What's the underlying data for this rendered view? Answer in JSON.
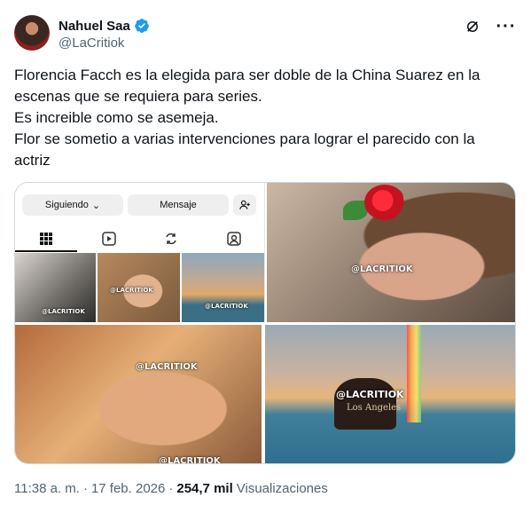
{
  "author": {
    "display_name": "Nahuel Saa",
    "handle": "@LaCritiok",
    "verified": true,
    "verified_color": "#1d9bf0"
  },
  "header_icons": [
    "grok-icon",
    "more-icon"
  ],
  "more_label": "···",
  "text_lines": [
    "Florencia Facch es la elegida para ser doble de la China Suarez en la",
    "escenas que se requiera para series.",
    "Es increible como se asemeja.",
    "Flor se sometio a varias intervenciones para lograr el parecido con la",
    "actriz"
  ],
  "media": {
    "instagram": {
      "follow_label": "Siguiendo",
      "message_label": "Mensaje",
      "tabs": [
        "grid-icon",
        "reels-icon",
        "repost-icon",
        "tagged-icon"
      ]
    },
    "watermark": "@LACRITIOK",
    "hat_text": "Los Angeles"
  },
  "footer": {
    "time": "11:38 a. m.",
    "separator": "·",
    "date": "17 feb. 2026",
    "views_count": "254,7 mil",
    "views_label": "Visualizaciones"
  },
  "colors": {
    "text": "#0f1419",
    "secondary": "#536471",
    "border": "#cfd9de"
  }
}
